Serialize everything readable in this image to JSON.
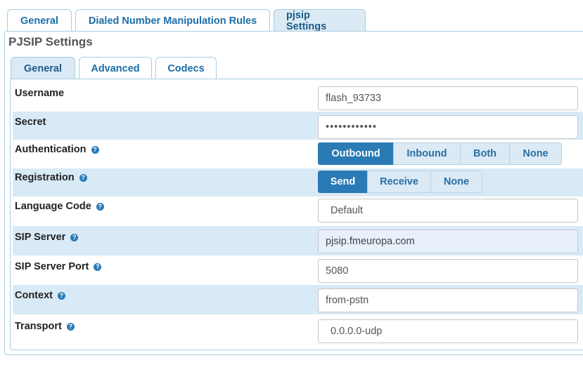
{
  "top_tabs": [
    {
      "label": "General"
    },
    {
      "label": "Dialed Number Manipulation Rules"
    },
    {
      "label": "pjsip Settings"
    }
  ],
  "section_title": "PJSIP Settings",
  "sub_tabs": [
    {
      "label": "General"
    },
    {
      "label": "Advanced"
    },
    {
      "label": "Codecs"
    }
  ],
  "form": {
    "username": {
      "label": "Username",
      "value": "flash_93733"
    },
    "secret": {
      "label": "Secret",
      "value": "••••••••••••"
    },
    "authentication": {
      "label": "Authentication",
      "options": [
        "Outbound",
        "Inbound",
        "Both",
        "None"
      ],
      "selected": "Outbound"
    },
    "registration": {
      "label": "Registration",
      "options": [
        "Send",
        "Receive",
        "None"
      ],
      "selected": "Send"
    },
    "language_code": {
      "label": "Language Code",
      "value": "Default"
    },
    "sip_server": {
      "label": "SIP Server",
      "value": "pjsip.fmeuropa.com"
    },
    "sip_server_port": {
      "label": "SIP Server Port",
      "value": "5080"
    },
    "context": {
      "label": "Context",
      "value": "from-pstn"
    },
    "transport": {
      "label": "Transport",
      "value": "0.0.0.0-udp"
    }
  },
  "help_glyph": "?",
  "colors": {
    "accent": "#2a7ab5",
    "row_alt": "#d9eaf7",
    "tab_active": "#dbeaf5"
  }
}
